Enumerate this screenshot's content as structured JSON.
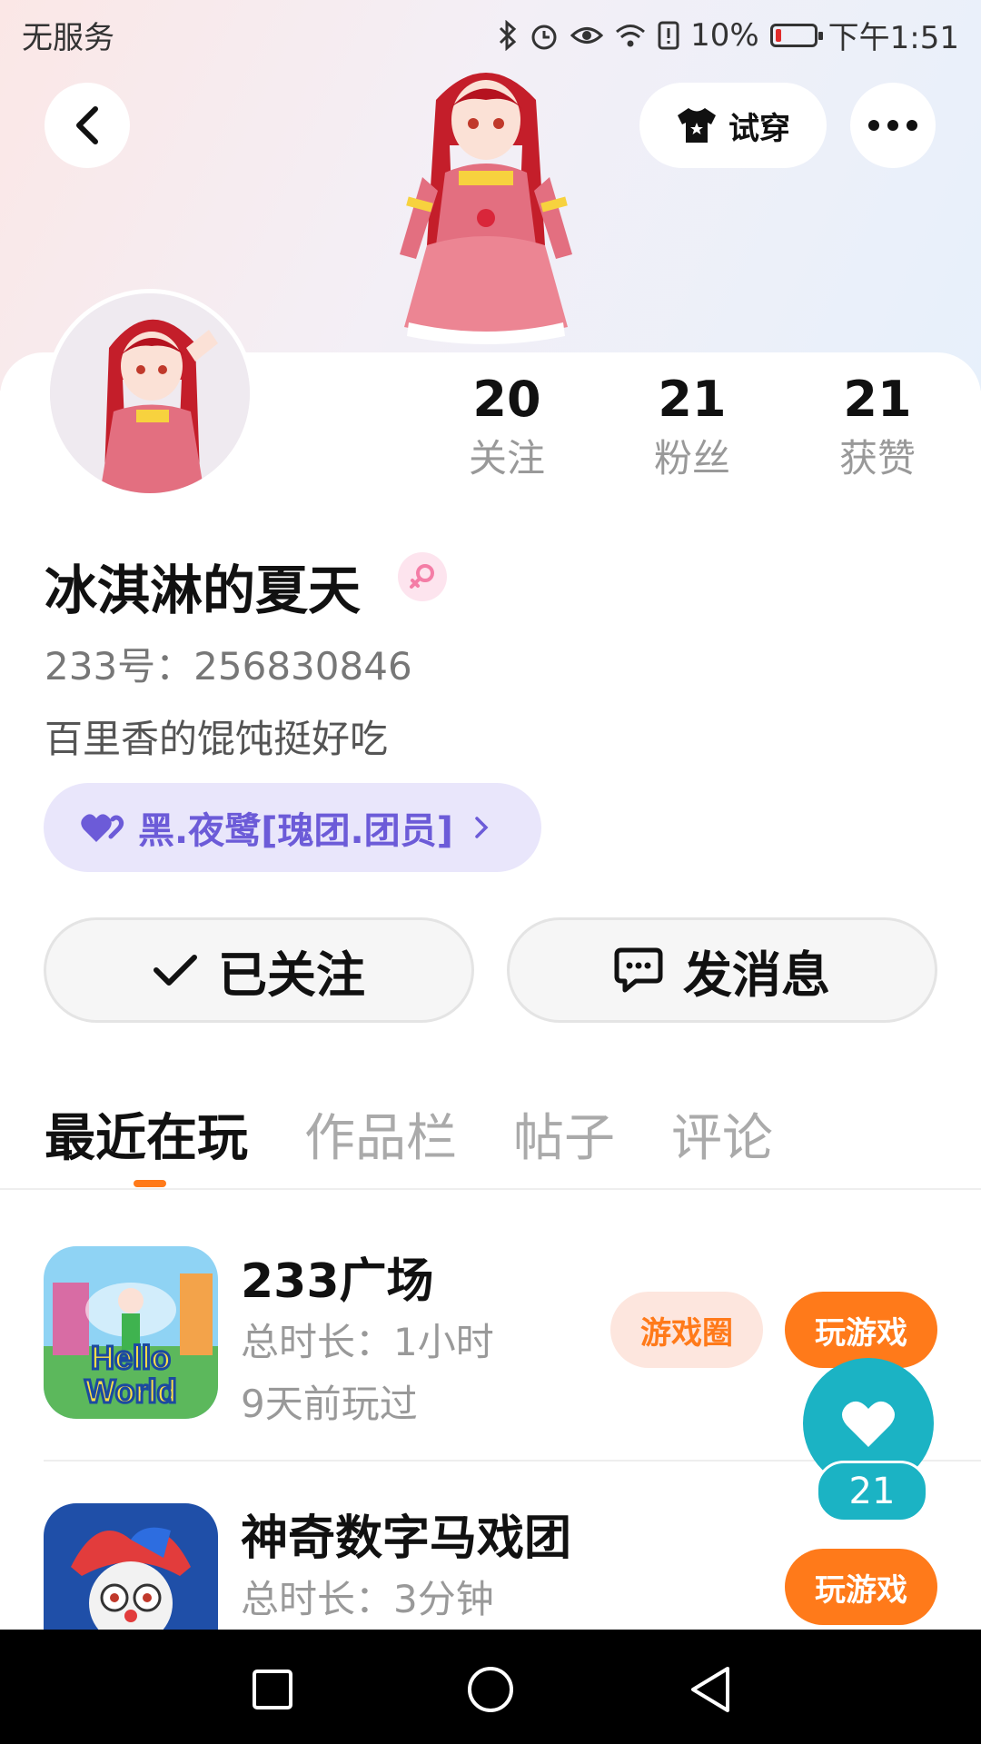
{
  "status_bar": {
    "carrier": "无服务",
    "battery_percent": "10%",
    "time": "下午1:51"
  },
  "header": {
    "try_on_label": "试穿"
  },
  "profile": {
    "username": "冰淇淋的夏天",
    "user_id": "233号：256830846",
    "bio": "百里香的馄饨挺好吃",
    "guild": "黑.夜鹭[瑰团.团员]",
    "stats": [
      {
        "value": "20",
        "label": "关注"
      },
      {
        "value": "21",
        "label": "粉丝"
      },
      {
        "value": "21",
        "label": "获赞"
      }
    ]
  },
  "actions": {
    "follow_label": "已关注",
    "message_label": "发消息"
  },
  "tabs": [
    "最近在玩",
    "作品栏",
    "帖子",
    "评论"
  ],
  "games": [
    {
      "name": "233广场",
      "duration": "总时长：1小时",
      "last_played": "9天前玩过",
      "circle_label": "游戏圈",
      "play_label": "玩游戏",
      "icon_text_1": "Hello",
      "icon_text_2": "World"
    },
    {
      "name": "神奇数字马戏团",
      "duration": "总时长：3分钟",
      "play_label": "玩游戏"
    }
  ],
  "like": {
    "count": "21"
  },
  "colors": {
    "accent_orange": "#ff7a1a",
    "fab_teal": "#1bb3c4",
    "guild_purple": "#6c5bd8"
  }
}
